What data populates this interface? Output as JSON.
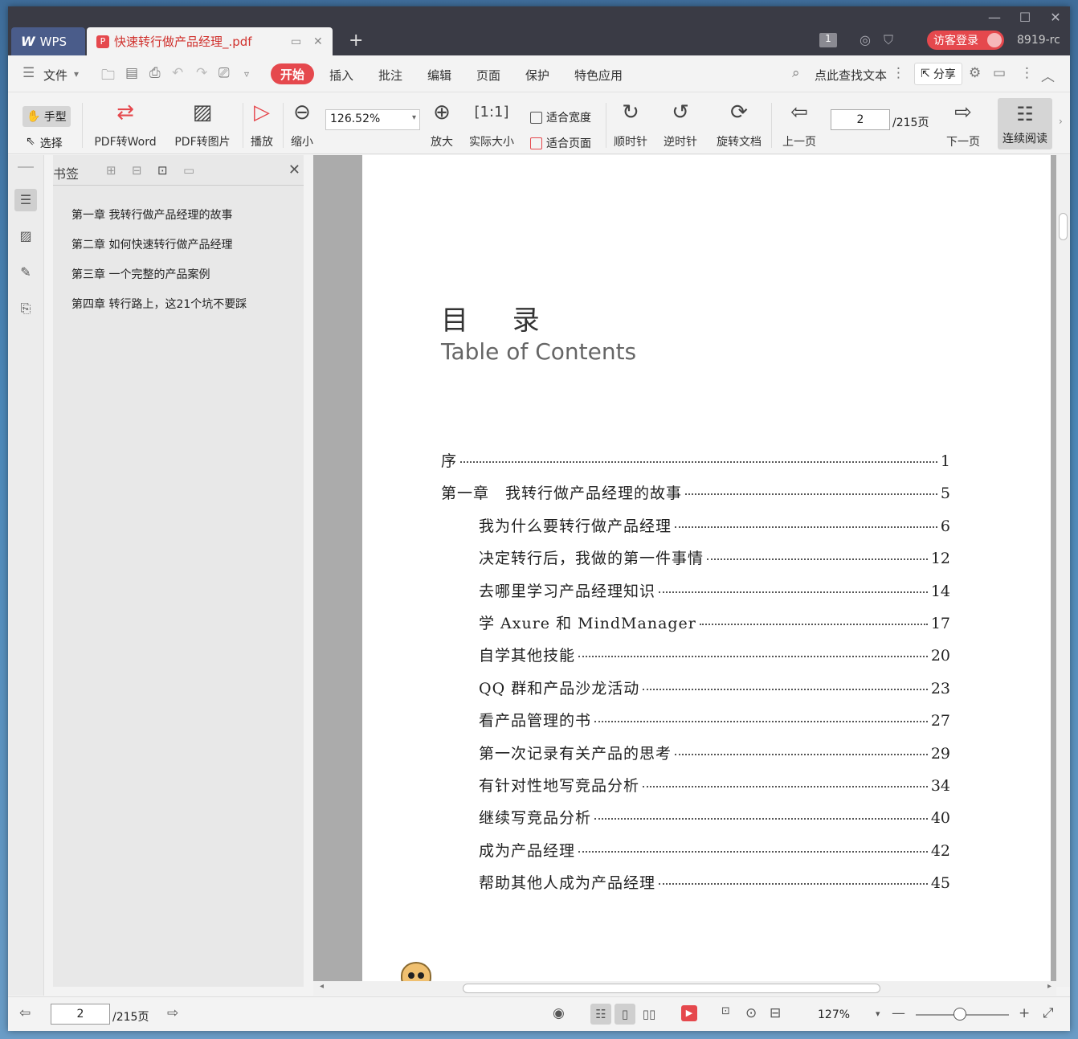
{
  "titlebar": {
    "app_tab": "WPS",
    "doc_tab": "快速转行做产品经理_.pdf",
    "badge_count": "1",
    "login_label": "访客登录",
    "user_id": "8919-rc"
  },
  "menu": {
    "file": "文件",
    "start": "开始",
    "insert": "插入",
    "annotate": "批注",
    "edit": "编辑",
    "page": "页面",
    "protect": "保护",
    "special": "特色应用",
    "search": "点此查找文本",
    "share": "分享"
  },
  "toolbar": {
    "hand": "手型",
    "select": "选择",
    "pdf_to_word": "PDF转Word",
    "pdf_to_image": "PDF转图片",
    "play": "播放",
    "zoom_out": "缩小",
    "zoom_value": "126.52%",
    "zoom_in": "放大",
    "actual_size": "实际大小",
    "fit_width": "适合宽度",
    "fit_page": "适合页面",
    "clockwise": "顺时针",
    "counter_clockwise": "逆时针",
    "rotate_doc": "旋转文档",
    "prev_page": "上一页",
    "current_page": "2",
    "total_pages": "/215页",
    "next_page": "下一页",
    "continuous": "连续阅读"
  },
  "bookmarks": {
    "title": "书签",
    "items": [
      "第一章 我转行做产品经理的故事",
      "第二章 如何快速转行做产品经理",
      "第三章 一个完整的产品案例",
      "第四章 转行路上，这21个坑不要踩"
    ]
  },
  "document": {
    "title_cn": "目 录",
    "title_en": "Table of Contents",
    "toc": [
      {
        "title": "序",
        "page": "1",
        "indent": false
      },
      {
        "title": "第一章　我转行做产品经理的故事",
        "page": "5",
        "indent": false
      },
      {
        "title": "我为什么要转行做产品经理",
        "page": "6",
        "indent": true
      },
      {
        "title": "决定转行后，我做的第一件事情",
        "page": "12",
        "indent": true
      },
      {
        "title": "去哪里学习产品经理知识",
        "page": "14",
        "indent": true
      },
      {
        "title": "学 Axure 和 MindManager",
        "page": "17",
        "indent": true
      },
      {
        "title": "自学其他技能",
        "page": "20",
        "indent": true
      },
      {
        "title": "QQ 群和产品沙龙活动",
        "page": "23",
        "indent": true
      },
      {
        "title": "看产品管理的书",
        "page": "27",
        "indent": true
      },
      {
        "title": "第一次记录有关产品的思考",
        "page": "29",
        "indent": true
      },
      {
        "title": "有针对性地写竞品分析",
        "page": "34",
        "indent": true
      },
      {
        "title": "继续写竞品分析",
        "page": "40",
        "indent": true
      },
      {
        "title": "成为产品经理",
        "page": "42",
        "indent": true
      },
      {
        "title": "帮助其他人成为产品经理",
        "page": "45",
        "indent": true
      }
    ]
  },
  "statusbar": {
    "current_page": "2",
    "total_pages": "/215页",
    "zoom": "127%"
  }
}
